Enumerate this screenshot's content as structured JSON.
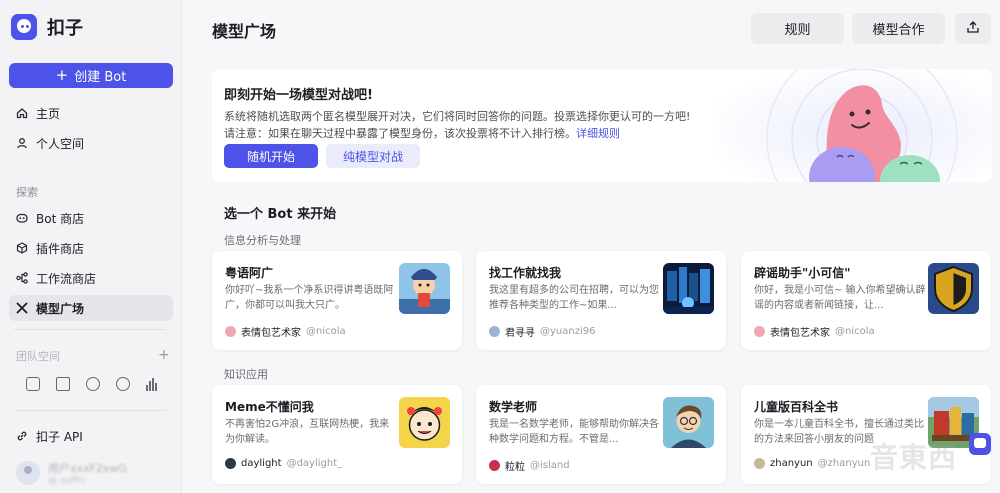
{
  "app": {
    "name": "扣子"
  },
  "sidebar": {
    "create_label": "创建 Bot",
    "nav": [
      {
        "label": "主页",
        "icon": "home-icon"
      },
      {
        "label": "个人空间",
        "icon": "user-icon"
      }
    ],
    "explore_label": "探索",
    "explore": [
      {
        "label": "Bot 商店",
        "icon": "bot-icon"
      },
      {
        "label": "插件商店",
        "icon": "cube-icon"
      },
      {
        "label": "工作流商店",
        "icon": "workflow-icon"
      },
      {
        "label": "模型广场",
        "icon": "tools-icon",
        "active": true
      }
    ],
    "team_label": "团队空间",
    "api_label": "扣子 API",
    "user_name": "用户xxxF2xwG",
    "user_sub": "@ xuffin"
  },
  "header": {
    "title": "模型广场",
    "rules_label": "规则",
    "cooperate_label": "模型合作"
  },
  "banner": {
    "title": "即刻开始一场模型对战吧!",
    "desc1": "系统将随机选取两个匿名模型展开对决，它们将同时回答你的问题。投票选择你更认可的一方吧!",
    "desc2": "请注意：如果在聊天过程中暴露了模型身份，该次投票将不计入排行榜。",
    "link": "详细规则",
    "btn_random": "随机开始",
    "btn_pure": "纯模型对战"
  },
  "main": {
    "choose_title": "选一个 Bot 来开始",
    "categories": [
      {
        "label": "信息分析与处理",
        "cards": [
          {
            "name": "粤语阿广",
            "desc": "你好吖~我系一个净系识得讲粤语既阿广，你都可以叫我大只广。",
            "author": "表情包艺术家",
            "handle": "@nicola"
          },
          {
            "name": "找工作就找我",
            "desc": "我这里有超多的公司在招聘，可以为您推荐各种类型的工作~如果...",
            "author": "君寻寻",
            "handle": "@yuanzi96"
          },
          {
            "name": "辟谣助手\"小可信\"",
            "desc": "你好，我是小可信~ 输入你希望确认辟谣的内容或者新闻链接，让...",
            "author": "表情包艺术家",
            "handle": "@nicola"
          }
        ]
      },
      {
        "label": "知识应用",
        "cards": [
          {
            "name": "Meme不懂问我",
            "desc": "不再害怕2G冲浪，互联网热梗，我来为你解读。",
            "author": "daylight",
            "handle": "@daylight_"
          },
          {
            "name": "数学老师",
            "desc": "我是一名数学老师，能够帮助你解决各种数学问题和方程。不管是...",
            "author": "粒粒",
            "handle": "@island"
          },
          {
            "name": "儿童版百科全书",
            "desc": "你是一本儿童百科全书，擅长通过类比的方法来回答小朋友的问题",
            "author": "zhanyun",
            "handle": "@zhanyun"
          }
        ]
      }
    ]
  },
  "watermark": "音東西",
  "colors": {
    "accent": "#4d53e8",
    "background": "#f7f7f9"
  }
}
